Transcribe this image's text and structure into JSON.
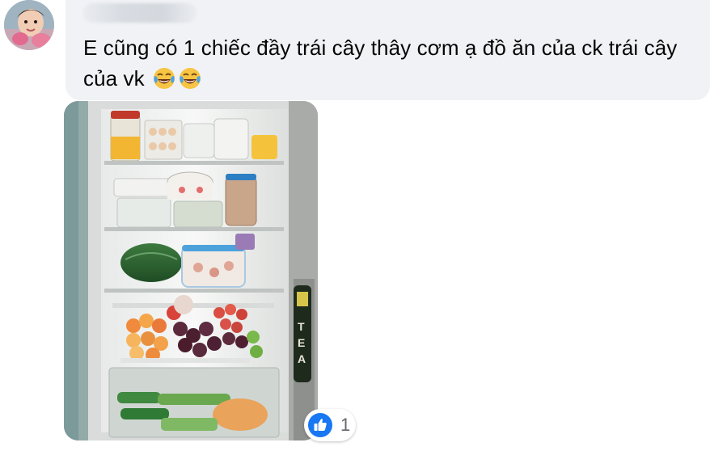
{
  "comment": {
    "author_name": "",
    "text": "E cũng có 1 chiếc đầy trái cây thây cơm ạ đồ ăn của ck trái cây của vk",
    "emojis": [
      "face-with-tears-of-joy-icon",
      "face-with-tears-of-joy-icon"
    ]
  },
  "attachment": {
    "type": "photo",
    "subject": "refrigerator-interior",
    "bottle_label": "TEA"
  },
  "reactions": {
    "icon": "like-icon",
    "count": "1",
    "color": "#1877f2"
  },
  "colors": {
    "bubble": "#f0f2f5",
    "text": "#050505",
    "count": "#65676b"
  }
}
